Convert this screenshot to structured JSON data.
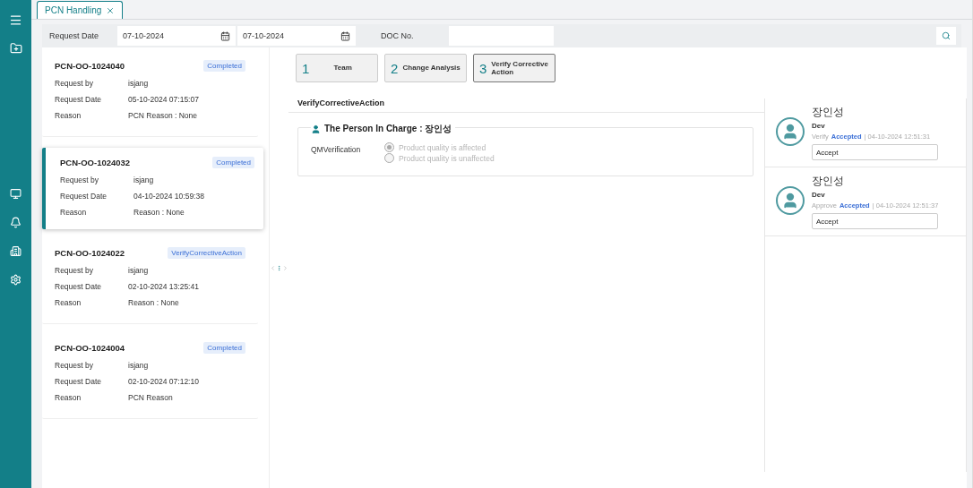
{
  "tabs": [
    {
      "label": "PCN Handling",
      "selected": true
    }
  ],
  "filter": {
    "request_date_label": "Request Date",
    "date_from": "07-10-2024",
    "date_to": "07-10-2024",
    "doc_no_label": "DOC No."
  },
  "requests": [
    {
      "number": "PCN-OO-1024040",
      "status": "Completed",
      "selected": false,
      "fields": [
        {
          "label": "Request by",
          "value": "isjang"
        },
        {
          "label": "Request Date",
          "value": "05-10-2024 07:15:07"
        },
        {
          "label": "Reason",
          "value": "PCN Reason : None"
        }
      ]
    },
    {
      "number": "PCN-OO-1024032",
      "status": "Completed",
      "selected": true,
      "fields": [
        {
          "label": "Request by",
          "value": "isjang"
        },
        {
          "label": "Request Date",
          "value": "04-10-2024 10:59:38"
        },
        {
          "label": "Reason",
          "value": "Reason : None"
        }
      ]
    },
    {
      "number": "PCN-OO-1024022",
      "status": "VerifyCorrectiveAction",
      "selected": false,
      "fields": [
        {
          "label": "Request by",
          "value": "isjang"
        },
        {
          "label": "Request Date",
          "value": "02-10-2024 13:25:41"
        },
        {
          "label": "Reason",
          "value": "Reason : None"
        }
      ]
    },
    {
      "number": "PCN-OO-1024004",
      "status": "Completed",
      "selected": false,
      "fields": [
        {
          "label": "Request by",
          "value": "isjang"
        },
        {
          "label": "Request Date",
          "value": "02-10-2024 07:12:10"
        },
        {
          "label": "Reason",
          "value": "PCN Reason"
        }
      ]
    }
  ],
  "steps": [
    {
      "number": "1",
      "label": "Team",
      "selected": false
    },
    {
      "number": "2",
      "label": "Change Analysis",
      "selected": false
    },
    {
      "number": "3",
      "label": "Verify Corrective Action",
      "selected": true
    }
  ],
  "section_title": "VerifyCorrectiveAction",
  "person_in_charge": "The Person In Charge : 장인성",
  "verification": {
    "label": "QMVerification",
    "disabled": true,
    "options": [
      {
        "label": "Product quality is affected",
        "selected": true
      },
      {
        "label": "Product quality is unaffected",
        "selected": false
      }
    ]
  },
  "approvals": [
    {
      "name": "장인성",
      "role": "Dev",
      "action": "Verify",
      "status": "Accepted",
      "date": "| 04-10-2024 12:51:31",
      "comment": "Accept"
    },
    {
      "name": "장인성",
      "role": "Dev",
      "action": "Approve",
      "status": "Accepted",
      "date": "| 04-10-2024 12:51:37",
      "comment": "Accept"
    }
  ]
}
